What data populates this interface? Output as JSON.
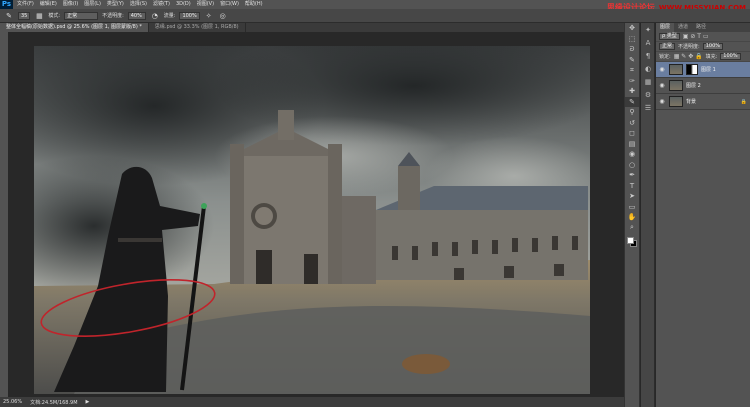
{
  "app": {
    "logo": "Ps"
  },
  "menu": [
    "文件(F)",
    "编辑(E)",
    "图像(I)",
    "图层(L)",
    "类型(Y)",
    "选择(S)",
    "滤镜(T)",
    "3D(D)",
    "视图(V)",
    "窗口(W)",
    "帮助(H)"
  ],
  "watermark": {
    "line1": "思缘设计论坛",
    "line2": "WWW.MISSYUAN.COM"
  },
  "options": {
    "brush_size": "35",
    "mode_label": "模式:",
    "mode_value": "正常",
    "opacity_label": "不透明度:",
    "opacity_value": "40%",
    "flow_label": "流量:",
    "flow_value": "100%"
  },
  "tabs": [
    {
      "label": "整体全幅稿(原始数据).psd @ 25.6% (图层 1, 图层蒙版/8) *",
      "active": true
    },
    {
      "label": "思缘.psd @ 33.3% (图层 1, RGB/8)",
      "active": false
    }
  ],
  "status": {
    "zoom": "25.06%",
    "doc": "文档:24.5M/168.9M"
  },
  "tools": [
    "move-icon",
    "marquee-icon",
    "lasso-icon",
    "quick-select-icon",
    "crop-icon",
    "eyedropper-icon",
    "healing-icon",
    "brush-icon",
    "stamp-icon",
    "history-brush-icon",
    "eraser-icon",
    "gradient-icon",
    "blur-icon",
    "dodge-icon",
    "pen-icon",
    "type-icon",
    "path-select-icon",
    "shape-icon",
    "hand-icon",
    "zoom-icon"
  ],
  "tool_glyphs": [
    "✥",
    "⬚",
    "ᘐ",
    "✎",
    "⌗",
    "✑",
    "✚",
    "✎",
    "⚲",
    "↺",
    "◻",
    "▤",
    "◉",
    "○",
    "✒",
    "T",
    "➤",
    "▭",
    "✋",
    "⌕"
  ],
  "dock": [
    "✦",
    "A",
    "¶",
    "◐",
    "▦",
    "⚙",
    "☰"
  ],
  "layers_panel": {
    "tabs": [
      "图层",
      "通道",
      "路径"
    ],
    "kind_label": "ρ 类型",
    "blend_mode": "正常",
    "opacity_label": "不透明度:",
    "opacity_value": "100%",
    "lock_label": "锁定:",
    "fill_label": "填充:",
    "fill_value": "100%",
    "layers": [
      {
        "name": "图层 1",
        "selected": true,
        "has_mask": true,
        "locked": false
      },
      {
        "name": "图层 2",
        "selected": false,
        "has_mask": false,
        "locked": false
      },
      {
        "name": "背景",
        "selected": false,
        "has_mask": false,
        "locked": true
      }
    ]
  }
}
